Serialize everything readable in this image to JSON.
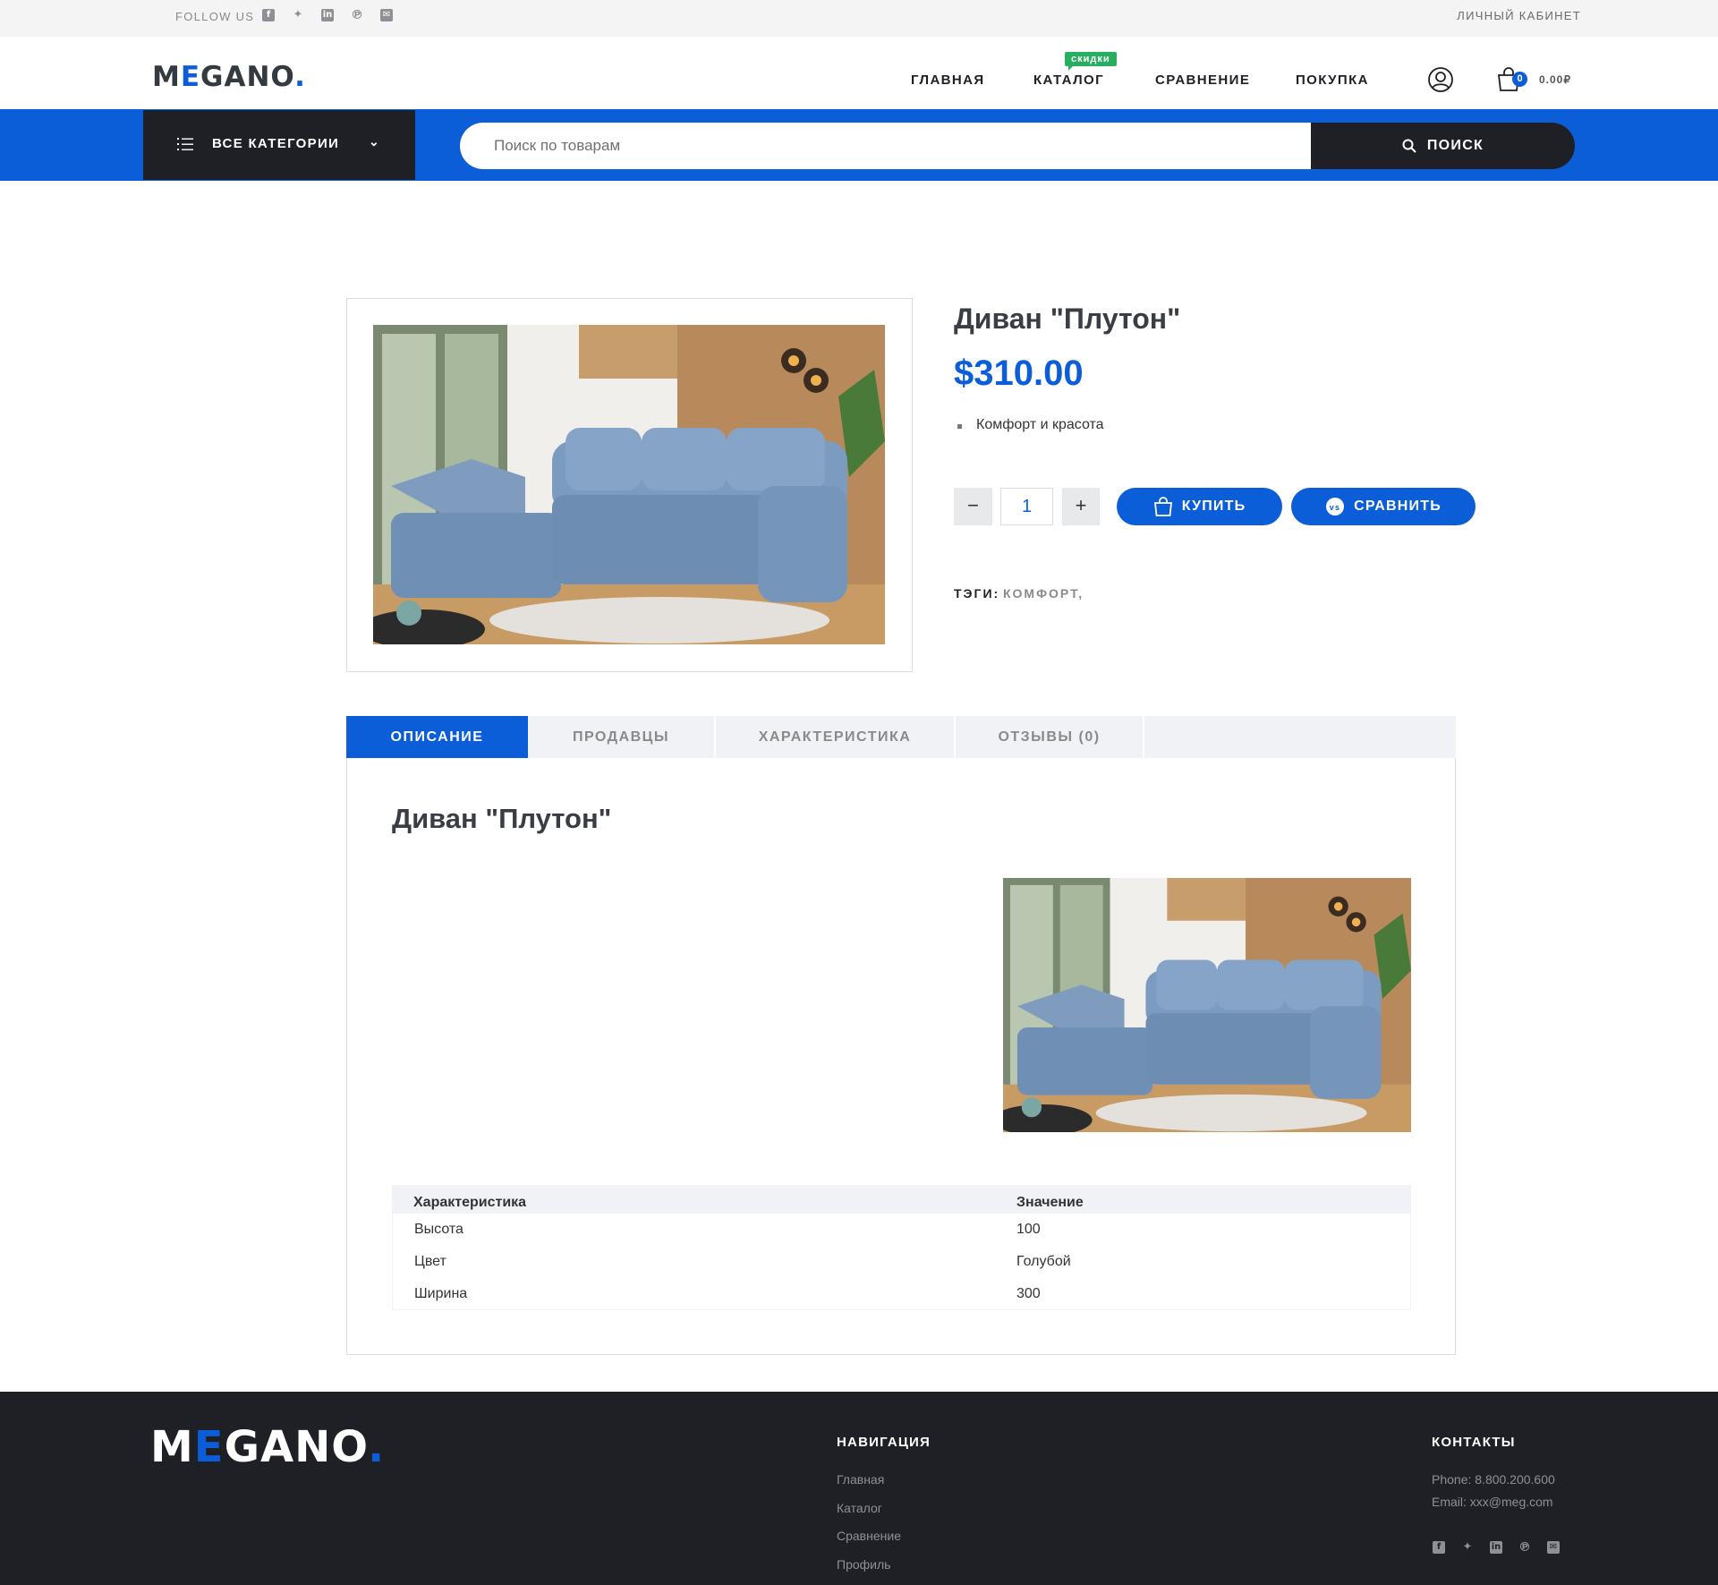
{
  "topbar": {
    "follow_label": "FOLLOW US",
    "social_icons": [
      "facebook-icon",
      "twitter-icon",
      "linkedin-icon",
      "pinterest-icon",
      "mail-icon"
    ],
    "account_link": "ЛИЧНЫЙ КАБИНЕТ"
  },
  "header": {
    "logo_m": "M",
    "logo_e": "E",
    "logo_rest": "GANO",
    "logo_dot": ".",
    "nav": [
      "ГЛАВНАЯ",
      "КАТАЛОГ",
      "СРАВНЕНИЕ",
      "ПОКУПКА"
    ],
    "catalog_badge": "скидки",
    "cart_count": "0",
    "cart_total": "0.00₽"
  },
  "searchbar": {
    "categories_label": "ВСЕ КАТЕГОРИИ",
    "placeholder": "Поиск по товарам",
    "search_button": "ПОИСК"
  },
  "product": {
    "title": "Диван \"Плутон\"",
    "price": "$310.00",
    "features": [
      "Комфорт и красота"
    ],
    "quantity": "1",
    "buy_button": "КУПИТЬ",
    "compare_button": "СРАВНИТЬ",
    "compare_badge": "vs",
    "tags_label": "ТЭГИ:",
    "tags": "КОМФОРТ,"
  },
  "tabs": {
    "items": [
      "ОПИСАНИЕ",
      "ПРОДАВЦЫ",
      "ХАРАКТЕРИСТИКА",
      "ОТЗЫВЫ (0)"
    ],
    "active": "ОПИСАНИЕ"
  },
  "description": {
    "title": "Диван \"Плутон\"",
    "spec_headers": [
      "Характеристика",
      "Значение"
    ],
    "spec_rows": [
      [
        "Высота",
        "100"
      ],
      [
        "Цвет",
        "Голубой"
      ],
      [
        "Ширина",
        "300"
      ]
    ]
  },
  "footer": {
    "logo_m": "M",
    "logo_e": "E",
    "logo_rest": "GANO",
    "logo_dot": ".",
    "nav_heading": "НАВИГАЦИЯ",
    "nav_links": [
      "Главная",
      "Каталог",
      "Сравнение",
      "Профиль"
    ],
    "contacts_heading": "КОНТАКТЫ",
    "phone": "Phone: 8.800.200.600",
    "email": "Email: xxx@meg.com"
  },
  "colors": {
    "accent": "#0b5ed7",
    "dark": "#1f2025",
    "badge_green": "#27ae60",
    "topbar_bg": "#f4f4f4"
  }
}
